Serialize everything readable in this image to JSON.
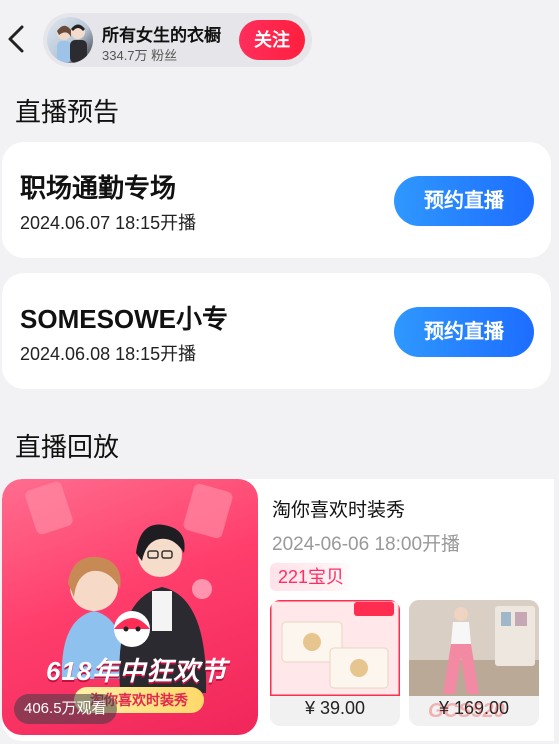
{
  "header": {
    "shop_name": "所有女生的衣橱",
    "fans": "334.7万 粉丝",
    "follow_label": "关注"
  },
  "preview": {
    "title": "直播预告",
    "cards": [
      {
        "title": "职场通勤专场",
        "time": "2024.06.07 18:15开播",
        "button": "预约直播"
      },
      {
        "title": "SOMESOWE小专",
        "time": "2024.06.08 18:15开播",
        "button": "预约直播"
      }
    ]
  },
  "replay": {
    "title": "直播回放",
    "item": {
      "name": "淘你喜欢时装秀",
      "time": "2024-06-06 18:00开播",
      "count_badge": "221宝贝",
      "viewers": "406.5万观看",
      "poster_fest": "618年中狂欢节",
      "poster_banner": "淘你喜欢时装秀",
      "products": [
        {
          "price": "¥ 39.00",
          "icon": "tissue-pack-image"
        },
        {
          "price": "¥ 169.00",
          "icon": "outfit-image"
        }
      ]
    }
  },
  "watermark": "GCS520",
  "colors": {
    "accent_red": "#ff2e5d",
    "accent_blue": "#1d6dff",
    "background": "#f2f2f4"
  }
}
